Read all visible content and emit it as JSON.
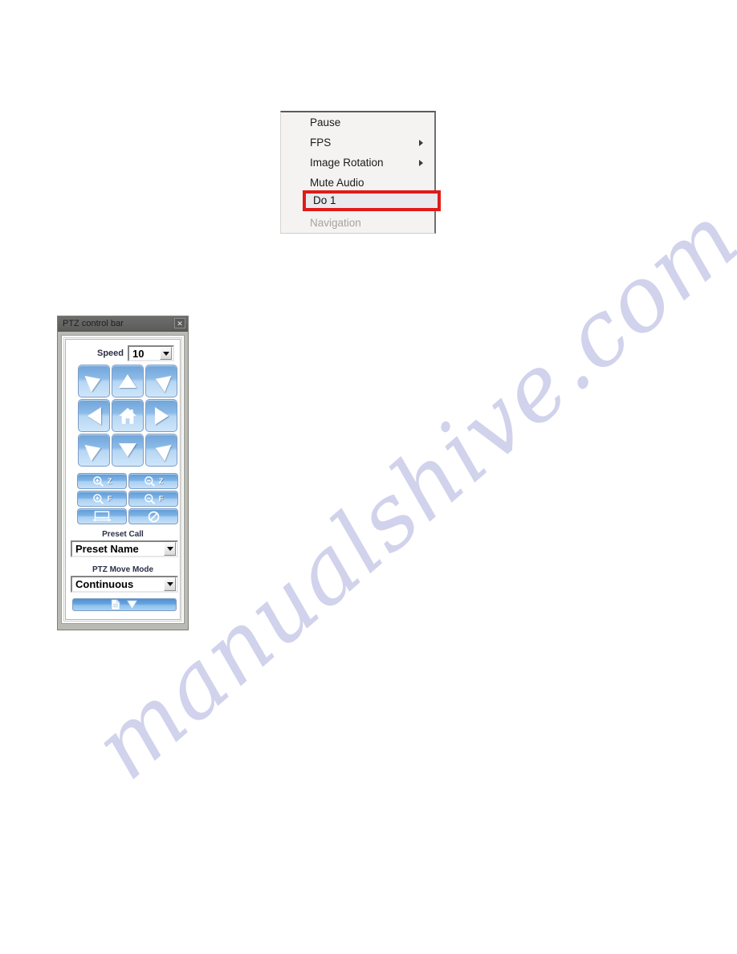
{
  "page": {
    "background_color": "#ffffff",
    "watermark": {
      "text": "manualshive.com",
      "color": "#c9cbe8"
    }
  },
  "context_menu": {
    "name": "video-context-menu",
    "background_color": "#f4f3f2",
    "highlight_color": "#e01b17",
    "items": [
      {
        "label": "Pause",
        "has_submenu": false,
        "disabled": false,
        "highlighted": false
      },
      {
        "label": "FPS",
        "has_submenu": true,
        "disabled": false,
        "highlighted": false
      },
      {
        "label": "Image Rotation",
        "has_submenu": true,
        "disabled": false,
        "highlighted": false
      },
      {
        "label": "Mute Audio",
        "has_submenu": false,
        "disabled": false,
        "highlighted": false
      },
      {
        "label": "Do 1",
        "has_submenu": false,
        "disabled": false,
        "highlighted": true
      },
      {
        "label": "Navigation",
        "has_submenu": false,
        "disabled": true,
        "highlighted": false
      }
    ]
  },
  "ptz_panel": {
    "title": "PTZ control bar",
    "close_label": "✕",
    "speed": {
      "label": "Speed",
      "value": "10"
    },
    "dpad": [
      {
        "icon": "arrow-up-left-icon",
        "position": "top-left"
      },
      {
        "icon": "arrow-up-icon",
        "position": "top-center"
      },
      {
        "icon": "arrow-up-right-icon",
        "position": "top-right"
      },
      {
        "icon": "arrow-left-icon",
        "position": "middle-left"
      },
      {
        "icon": "home-icon",
        "position": "center"
      },
      {
        "icon": "arrow-right-icon",
        "position": "middle-right"
      },
      {
        "icon": "arrow-down-left-icon",
        "position": "bottom-left"
      },
      {
        "icon": "arrow-down-icon",
        "position": "bottom-center"
      },
      {
        "icon": "arrow-down-right-icon",
        "position": "bottom-right"
      }
    ],
    "function_buttons": [
      {
        "icon": "zoom-in-icon",
        "letter": "Z",
        "name": "zoom-in-button"
      },
      {
        "icon": "zoom-out-icon",
        "letter": "Z",
        "name": "zoom-out-button"
      },
      {
        "icon": "focus-near-icon",
        "letter": "F",
        "name": "focus-near-button"
      },
      {
        "icon": "focus-far-icon",
        "letter": "F",
        "name": "focus-far-button"
      },
      {
        "icon": "auto-pan-icon",
        "letter": "",
        "name": "auto-pan-button"
      },
      {
        "icon": "stop-icon",
        "letter": "",
        "name": "stop-button"
      }
    ],
    "preset_call": {
      "label": "Preset Call",
      "value": "Preset Name"
    },
    "move_mode": {
      "label": "PTZ Move Mode",
      "value": "Continuous"
    },
    "bottom_button": {
      "icons": [
        "document-icon",
        "triangle-down-icon"
      ]
    }
  }
}
